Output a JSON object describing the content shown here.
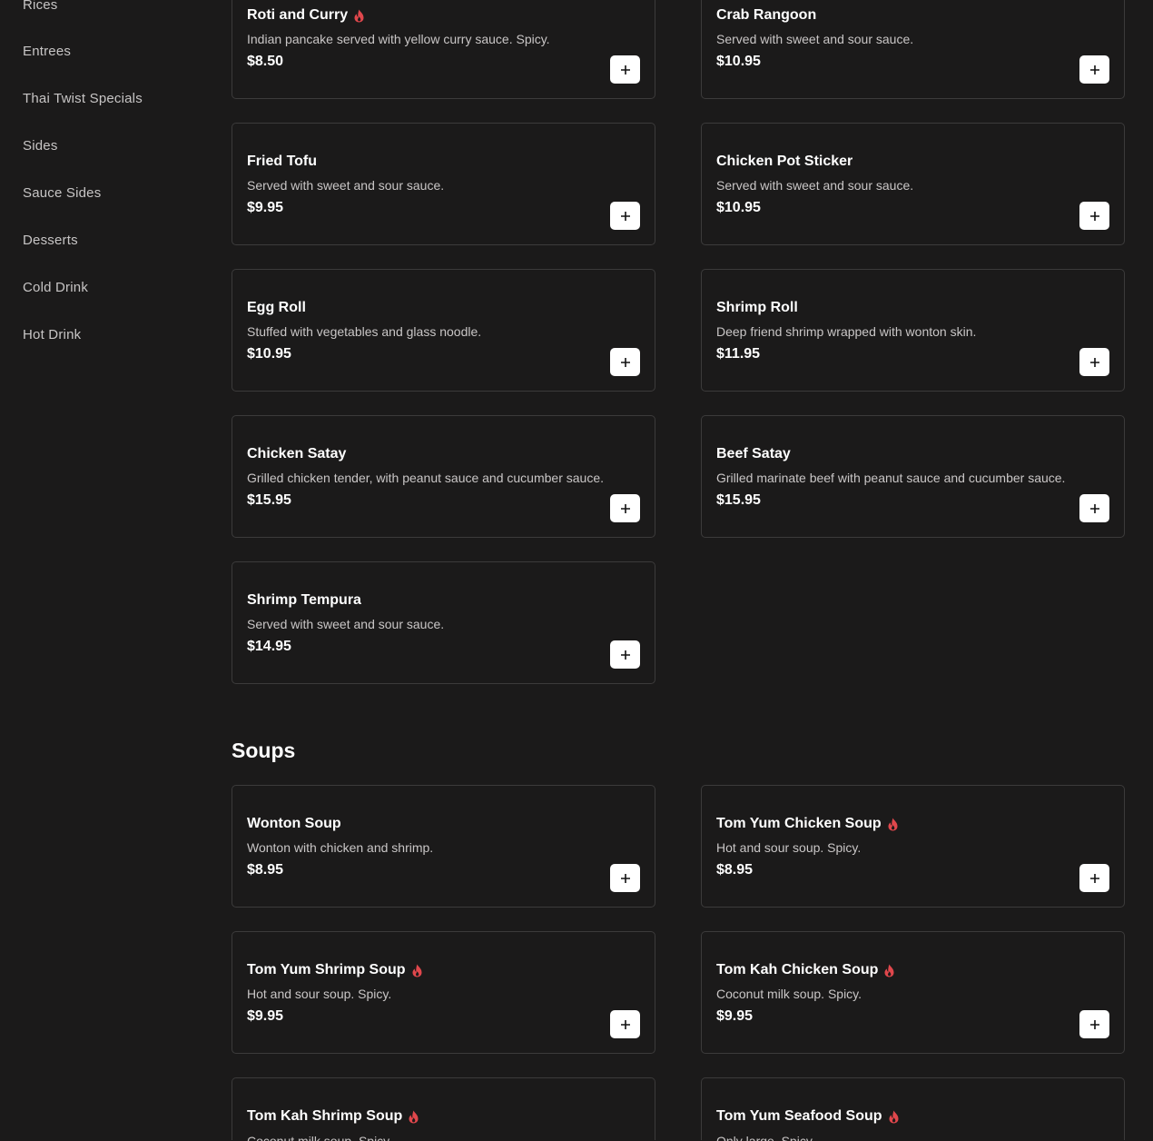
{
  "sidebar": {
    "items": [
      {
        "label": "Rices"
      },
      {
        "label": "Entrees"
      },
      {
        "label": "Thai Twist Specials"
      },
      {
        "label": "Sides"
      },
      {
        "label": "Sauce Sides"
      },
      {
        "label": "Desserts"
      },
      {
        "label": "Cold Drink"
      },
      {
        "label": "Hot Drink"
      }
    ]
  },
  "appetizers": {
    "items": [
      {
        "name": "Roti and Curry",
        "desc": "Indian pancake served with yellow curry sauce. Spicy.",
        "price": "$8.50",
        "spicy": true
      },
      {
        "name": "Crab Rangoon",
        "desc": "Served with sweet and sour sauce.",
        "price": "$10.95",
        "spicy": false
      },
      {
        "name": "Fried Tofu",
        "desc": "Served with sweet and sour sauce.",
        "price": "$9.95",
        "spicy": false
      },
      {
        "name": "Chicken Pot Sticker",
        "desc": "Served with sweet and sour sauce.",
        "price": "$10.95",
        "spicy": false
      },
      {
        "name": "Egg Roll",
        "desc": "Stuffed with vegetables and glass noodle.",
        "price": "$10.95",
        "spicy": false
      },
      {
        "name": "Shrimp Roll",
        "desc": "Deep friend shrimp wrapped with wonton skin.",
        "price": "$11.95",
        "spicy": false
      },
      {
        "name": "Chicken Satay",
        "desc": "Grilled chicken tender, with peanut sauce and cucumber sauce.",
        "price": "$15.95",
        "spicy": false
      },
      {
        "name": "Beef Satay",
        "desc": "Grilled marinate beef with peanut sauce and cucumber sauce.",
        "price": "$15.95",
        "spicy": false
      },
      {
        "name": "Shrimp Tempura",
        "desc": "Served with sweet and sour sauce.",
        "price": "$14.95",
        "spicy": false
      }
    ]
  },
  "soups": {
    "title": "Soups",
    "items": [
      {
        "name": "Wonton Soup",
        "desc": "Wonton with chicken and shrimp.",
        "price": "$8.95",
        "spicy": false
      },
      {
        "name": "Tom Yum Chicken Soup",
        "desc": "Hot and sour soup. Spicy.",
        "price": "$8.95",
        "spicy": true
      },
      {
        "name": "Tom Yum Shrimp Soup",
        "desc": "Hot and sour soup. Spicy.",
        "price": "$9.95",
        "spicy": true
      },
      {
        "name": "Tom Kah Chicken Soup",
        "desc": "Coconut milk soup. Spicy.",
        "price": "$9.95",
        "spicy": true
      },
      {
        "name": "Tom Kah Shrimp Soup",
        "desc": "Coconut milk soup. Spicy.",
        "price": "",
        "spicy": true
      },
      {
        "name": "Tom Yum Seafood Soup",
        "desc": "Only large. Spicy.",
        "price": "",
        "spicy": true
      }
    ]
  },
  "icons": {
    "spicy": "flame-icon",
    "add": "plus-icon"
  },
  "colors": {
    "background": "#1b1a1a",
    "card_border": "#3c3b3b",
    "spicy": "#e0474c",
    "button": "#ffffff"
  }
}
